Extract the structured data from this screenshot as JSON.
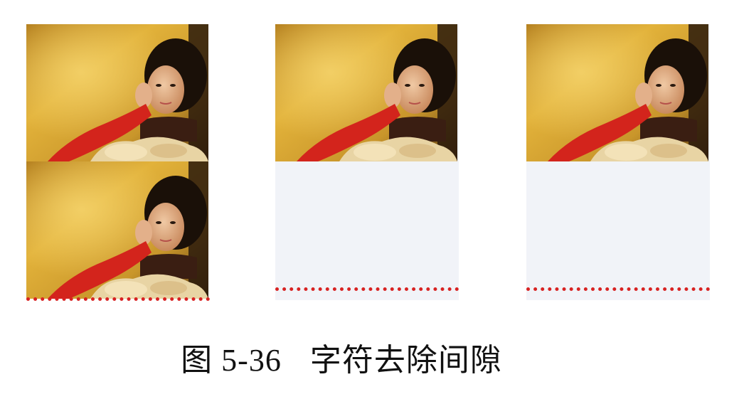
{
  "figure": {
    "number": "图 5-36",
    "title": "字符去除间隙"
  },
  "panels": [
    {
      "images": 2,
      "has_gap": false
    },
    {
      "images": 1,
      "has_gap": true
    },
    {
      "images": 1,
      "has_gap": true
    }
  ],
  "colors": {
    "panel_bg": "#f1f3f8",
    "dotted_line": "#d82222"
  }
}
